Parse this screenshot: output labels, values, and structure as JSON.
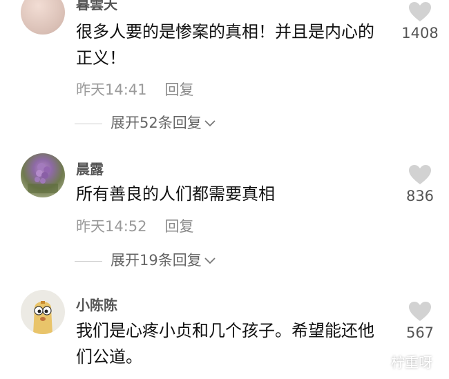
{
  "comments": [
    {
      "username": "暮雲天",
      "text": "很多人要的是惨案的真相！并且是内心的正义！",
      "time": "昨天14:41",
      "reply_label": "回复",
      "likes": "1408",
      "expand_label": "展开52条回复"
    },
    {
      "username": "晨露",
      "text": "所有善良的人们都需要真相",
      "time": "昨天14:52",
      "reply_label": "回复",
      "likes": "836",
      "expand_label": "展开19条回复"
    },
    {
      "username": "小陈陈",
      "text": "我们是心疼小贞和几个孩子。希望能还他们公道。",
      "likes": "567"
    }
  ],
  "watermark": "柠重呀",
  "colors": {
    "like_icon": "#d2d2d2",
    "muted_text": "#9a9a9a"
  }
}
